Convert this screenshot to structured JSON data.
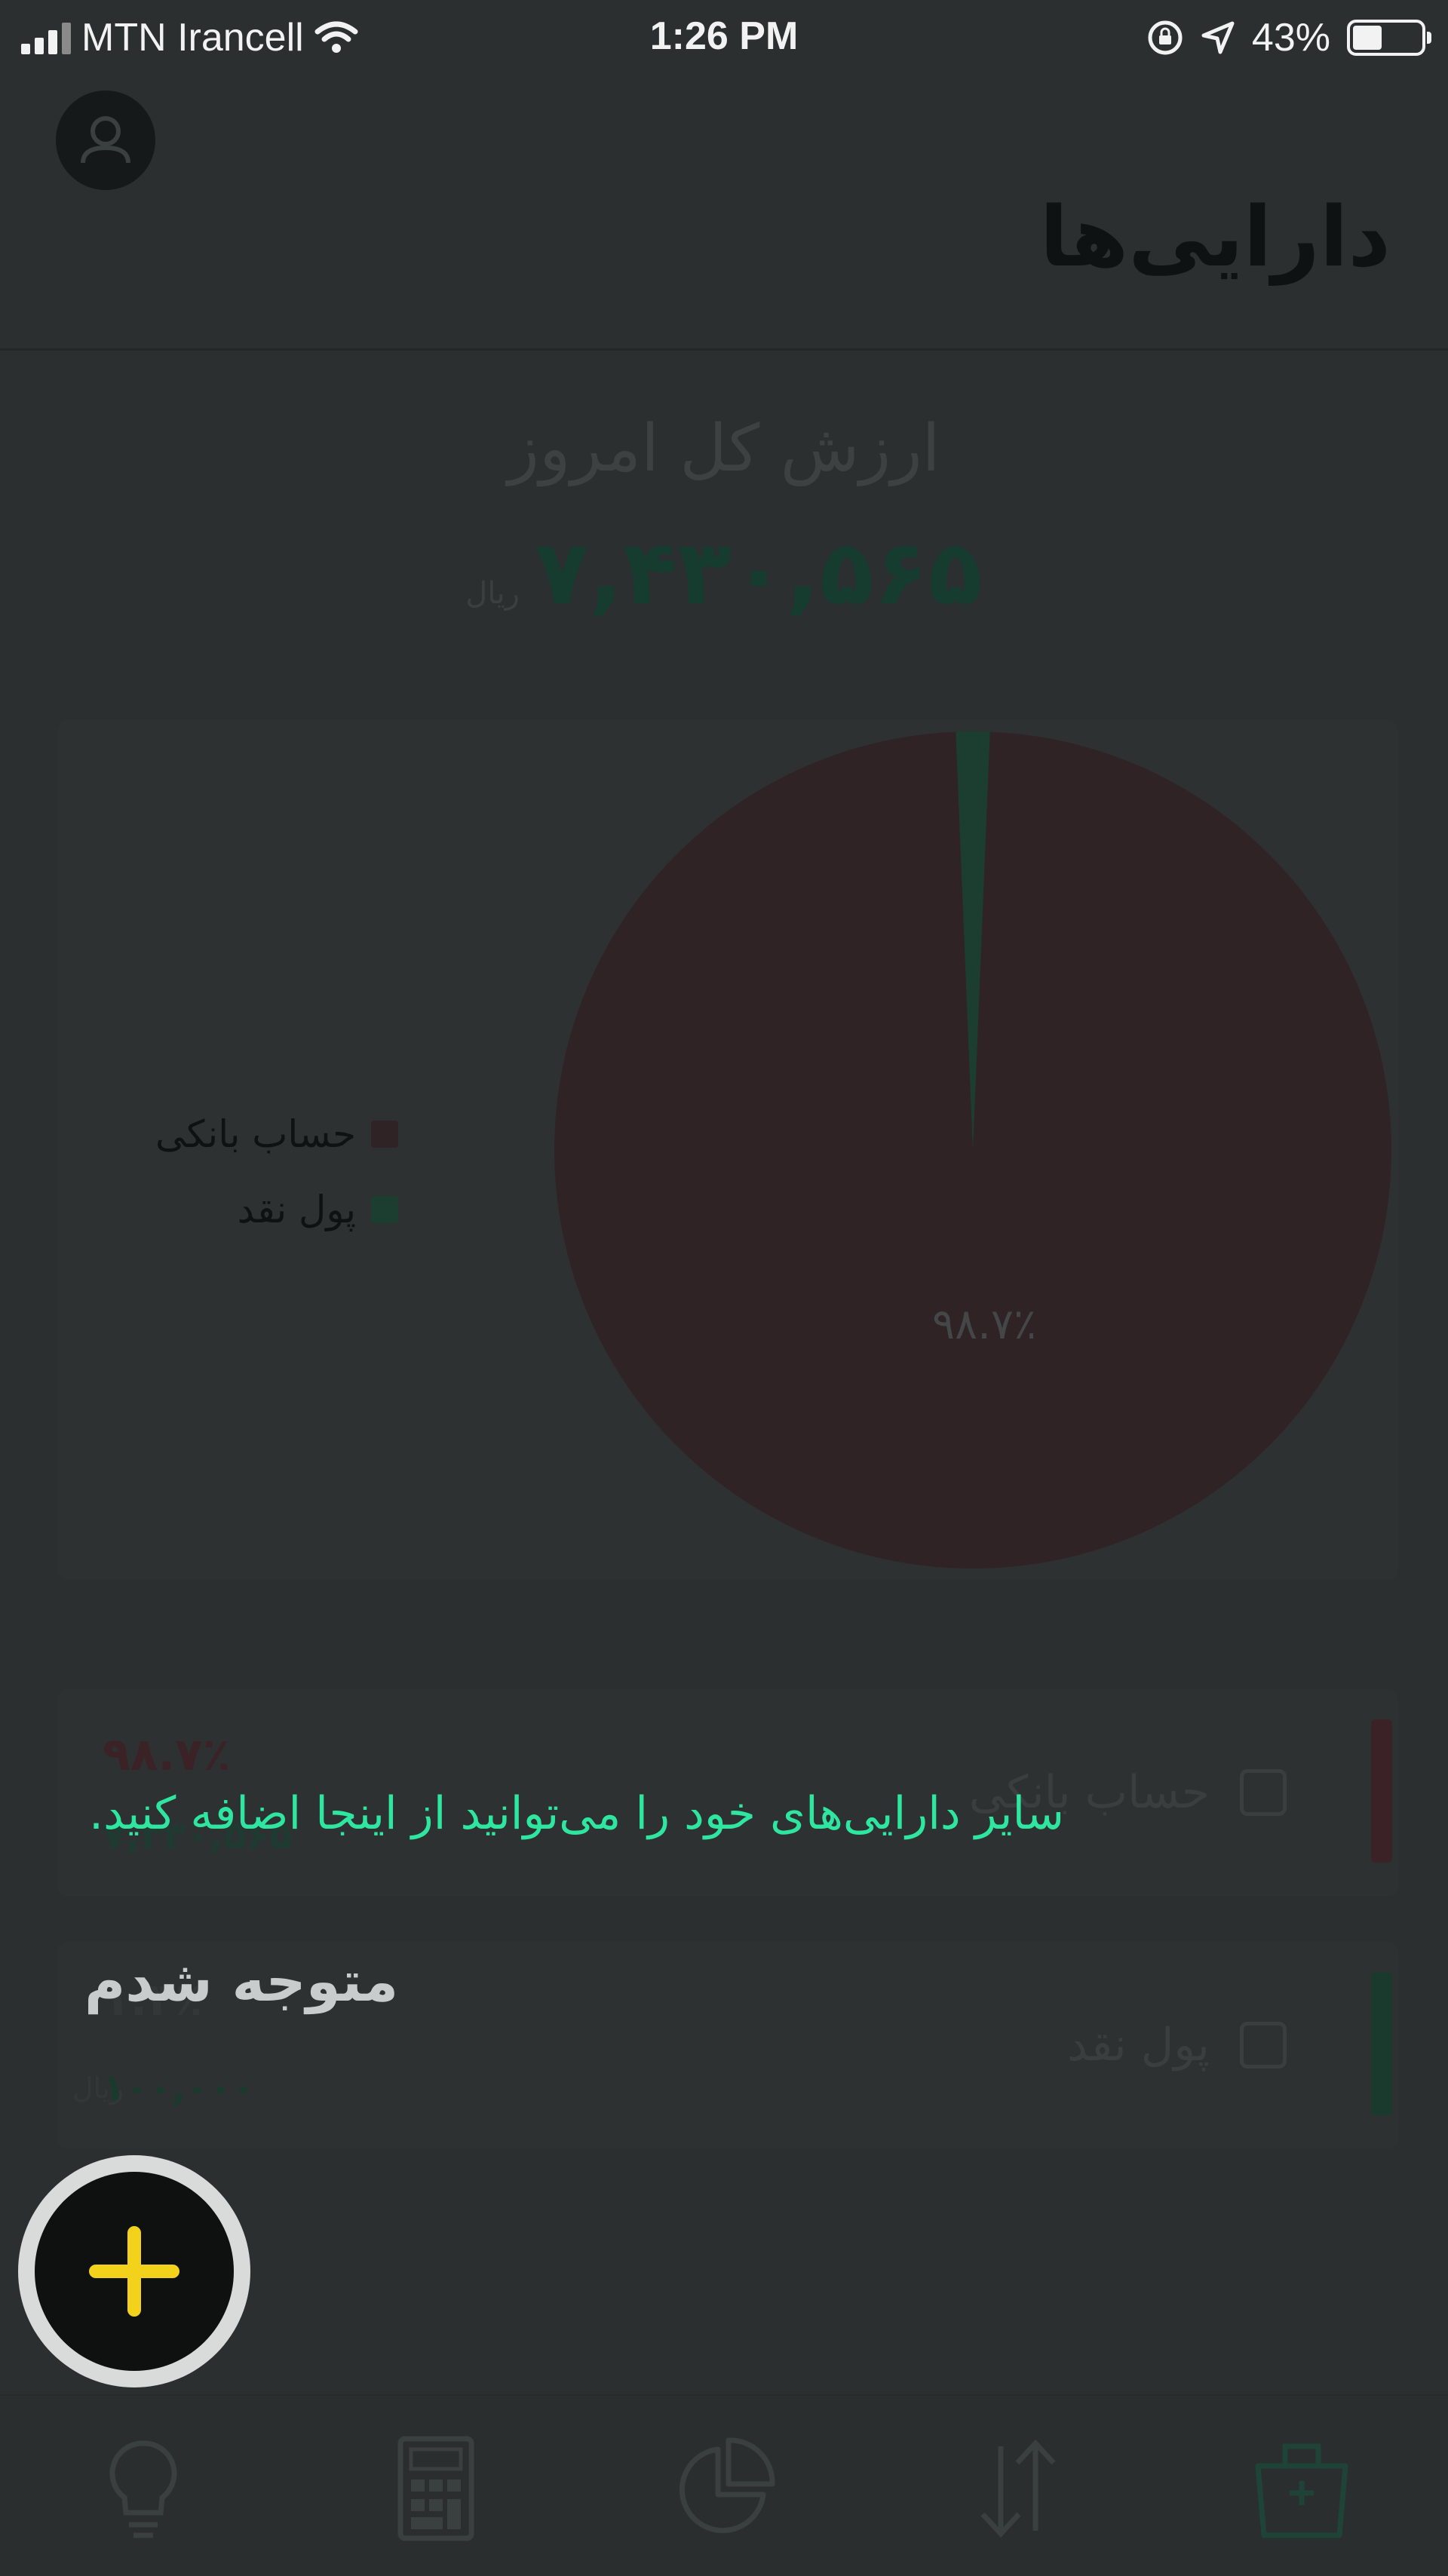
{
  "status_bar": {
    "carrier": "MTN Irancell",
    "time": "1:26 PM",
    "battery_text": "43%",
    "battery_level": 0.43
  },
  "header": {
    "title": "دارایی‌ها",
    "avatar_icon": "user-icon"
  },
  "summary": {
    "label": "ارزش کل امروز",
    "value": "۷,۴۳۰,۵۶۵",
    "unit": "ریال"
  },
  "chart_data": {
    "type": "pie",
    "labels": [
      "حساب بانکی",
      "پول نقد"
    ],
    "values": [
      98.7,
      1.3
    ],
    "colors": [
      "#2f2326",
      "#1c3e31"
    ],
    "slice_label": "۹۸.۷٪",
    "legend_position": "left"
  },
  "assets": [
    {
      "name": "حساب بانکی",
      "percent": "۹۸.۷٪",
      "amount": "۷,۳۳۰,۵۶۵",
      "unit": "ریال",
      "color": "#3b2227"
    },
    {
      "name": "پول نقد",
      "percent": "۱.۳٪",
      "amount": "۱۰۰,۰۰۰",
      "unit": "ریال",
      "color": "#1b3a2e"
    }
  ],
  "coach": {
    "message": "سایر دارایی‌های خود را می‌توانید از اینجا اضافه کنید.",
    "dismiss_label": "متوجه شدم"
  },
  "fab": {
    "icon": "plus-icon",
    "color": "#f2d21a"
  },
  "tabbar": {
    "icons": [
      "lightbulb-icon",
      "calculator-icon",
      "pie-chart-icon",
      "transfer-arrows-icon",
      "briefcase-icon"
    ],
    "active": "briefcase-icon"
  }
}
